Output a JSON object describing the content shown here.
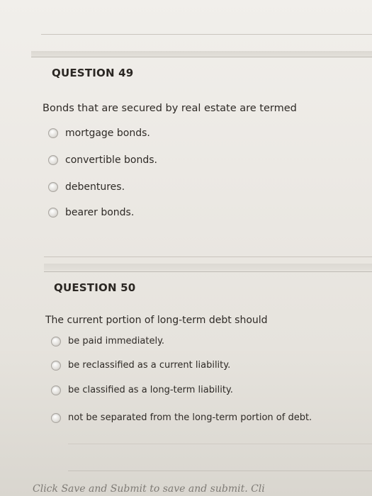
{
  "questions": [
    {
      "title": "QUESTION 49",
      "text": "Bonds that are secured by real estate are termed",
      "options": [
        "mortgage bonds.",
        "convertible bonds.",
        "debentures.",
        "bearer bonds."
      ]
    },
    {
      "title": "QUESTION 50",
      "text": "The current portion of long-term debt should",
      "options": [
        "be paid immediately.",
        "be reclassified as a current liability.",
        "be classified as a long-term liability.",
        "not be separated from the long-term portion of debt."
      ]
    }
  ],
  "footer": {
    "submit_text": "Click Save and Submit to save and submit. Cli"
  }
}
